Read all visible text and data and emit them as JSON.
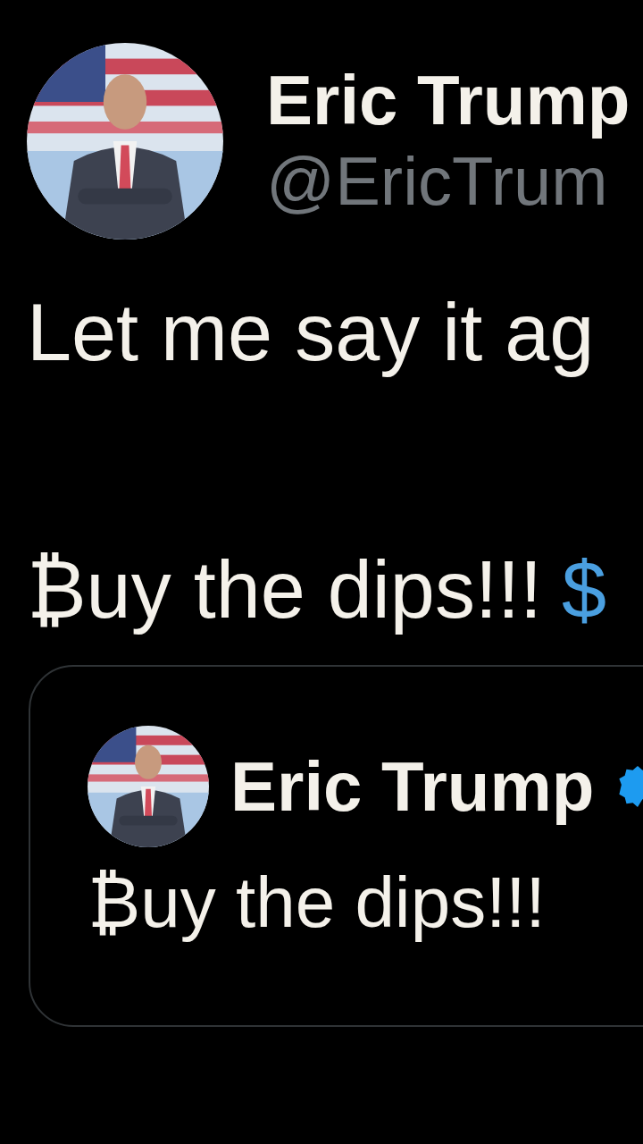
{
  "author": {
    "name": "Eric Trump",
    "handle": "@EricTrum"
  },
  "body": [
    {
      "text": "Let me say it ag"
    },
    {
      "text": "₿uy the dips!!!",
      "cashtag": "$"
    }
  ],
  "quote": {
    "author": {
      "name": "Eric Trump",
      "verified": true
    },
    "text": "₿uy the dips!!!"
  }
}
